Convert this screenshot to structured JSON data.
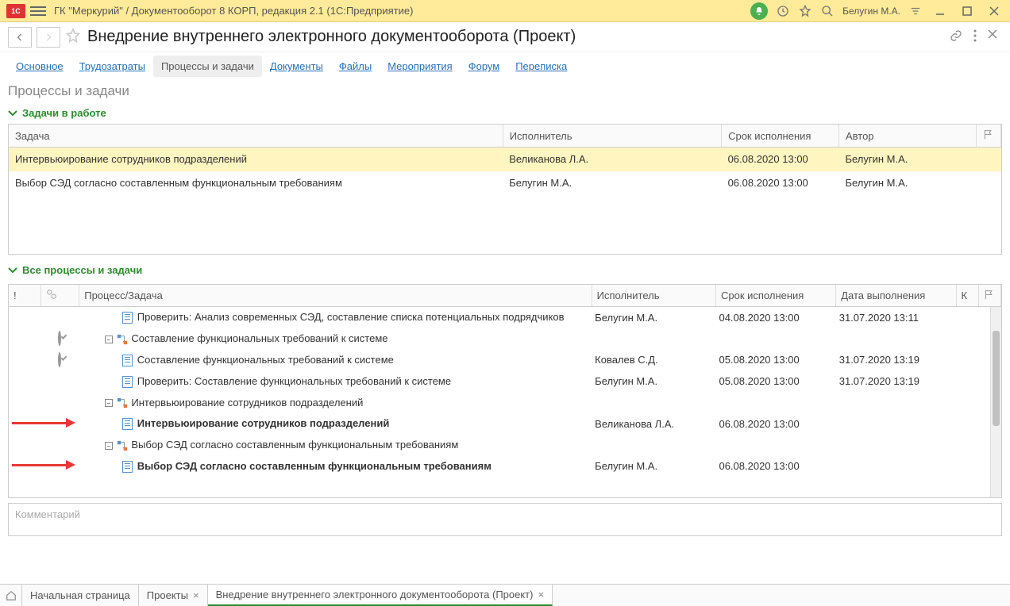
{
  "titlebar": {
    "logo": "1C",
    "title": "ГК \"Меркурий\" / Документооборот 8 КОРП, редакция 2.1  (1С:Предприятие)",
    "user": "Белугин М.А."
  },
  "page": {
    "title": "Внедрение внутреннего электронного документооборота (Проект)"
  },
  "tabs": {
    "items": [
      {
        "label": "Основное"
      },
      {
        "label": "Трудозатраты"
      },
      {
        "label": "Процессы и задачи",
        "active": true
      },
      {
        "label": "Документы"
      },
      {
        "label": "Файлы"
      },
      {
        "label": "Мероприятия"
      },
      {
        "label": "Форум"
      },
      {
        "label": "Переписка"
      }
    ]
  },
  "section": {
    "title": "Процессы и задачи"
  },
  "group1": {
    "header": "Задачи в работе",
    "cols": {
      "task": "Задача",
      "executor": "Исполнитель",
      "due": "Срок исполнения",
      "author": "Автор"
    },
    "rows": [
      {
        "task": "Интервьюирование сотрудников подразделений",
        "executor": "Великанова Л.А.",
        "due": "06.08.2020 13:00",
        "author": "Белугин М.А.",
        "highlight": true
      },
      {
        "task": "Выбор СЭД согласно составленным функциональным требованиям",
        "executor": "Белугин М.А.",
        "due": "06.08.2020 13:00",
        "author": "Белугин М.А."
      }
    ]
  },
  "group2": {
    "header": "Все процессы и задачи",
    "cols": {
      "ex": "!",
      "proc": "Процесс/Задача",
      "executor": "Исполнитель",
      "due": "Срок исполнения",
      "done": "Дата выполнения",
      "k": "К"
    },
    "rows": [
      {
        "status": "green",
        "type": "doc",
        "indent": 2,
        "text": "Проверить: Анализ современных СЭД, составление списка потенциальных подрядчиков",
        "executor": "Белугин М.А.",
        "due": "04.08.2020 13:00",
        "done": "31.07.2020 13:11"
      },
      {
        "status": "ring",
        "type": "proc",
        "indent": 1,
        "text": "Составление функциональных требований к системе"
      },
      {
        "status": "ring",
        "type": "doc",
        "indent": 2,
        "text": "Составление функциональных требований к системе",
        "executor": "Ковалев С.Д.",
        "due": "05.08.2020 13:00",
        "done": "31.07.2020 13:19"
      },
      {
        "status": "green",
        "type": "doc",
        "indent": 2,
        "text": "Проверить: Составление функциональных требований к системе",
        "executor": "Белугин М.А.",
        "due": "05.08.2020 13:00",
        "done": "31.07.2020 13:19"
      },
      {
        "status": "",
        "type": "proc",
        "indent": 1,
        "text": "Интервьюирование сотрудников подразделений"
      },
      {
        "status": "arrow",
        "type": "doc",
        "indent": 2,
        "bold": true,
        "text": "Интервьюирование сотрудников подразделений",
        "executor": "Великанова Л.А.",
        "due": "06.08.2020 13:00"
      },
      {
        "status": "",
        "type": "proc",
        "indent": 1,
        "text": "Выбор СЭД согласно составленным функциональным требованиям"
      },
      {
        "status": "arrow",
        "type": "doc",
        "indent": 2,
        "bold": true,
        "text": "Выбор СЭД согласно составленным функциональным требованиям",
        "executor": "Белугин М.А.",
        "due": "06.08.2020 13:00"
      }
    ]
  },
  "comment": {
    "placeholder": "Комментарий"
  },
  "bottomtabs": {
    "items": [
      {
        "label": "Начальная страница",
        "closable": false
      },
      {
        "label": "Проекты",
        "closable": true
      },
      {
        "label": "Внедрение внутреннего электронного документооборота (Проект)",
        "closable": true,
        "active": true
      }
    ]
  }
}
